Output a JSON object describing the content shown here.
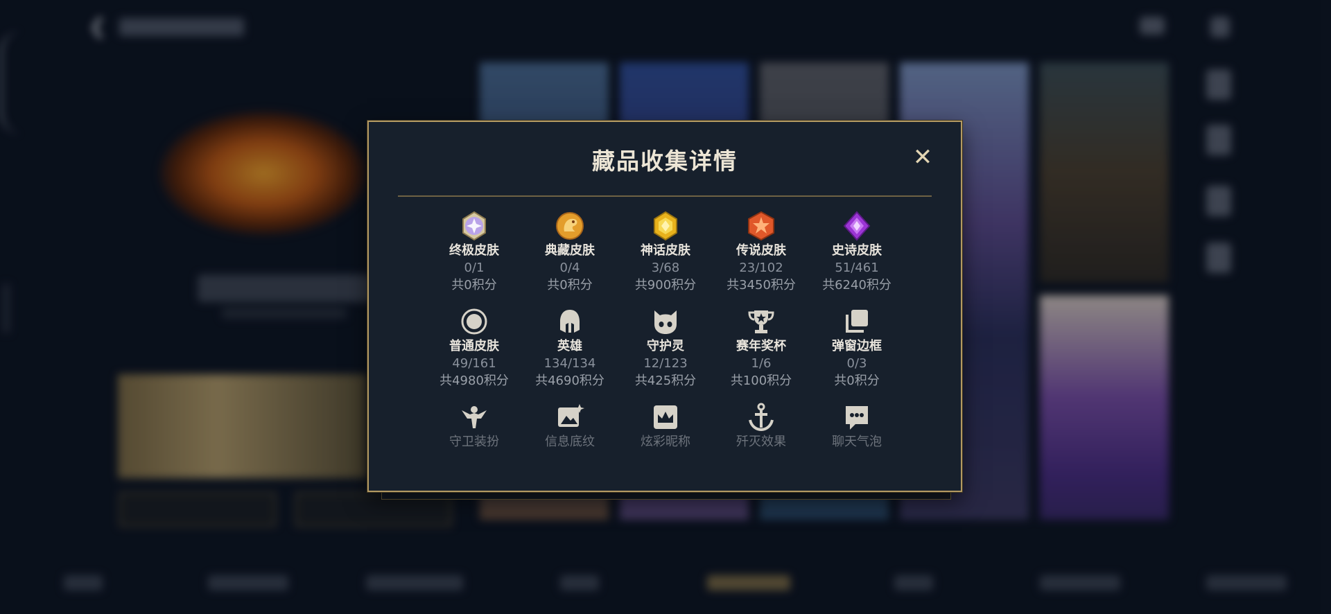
{
  "dialog": {
    "title": "藏品收集详情",
    "close_icon": "close-icon"
  },
  "colors": {
    "gold_border": "#b49a62",
    "dialog_bg": "#17202c",
    "title_text": "#ece5d5",
    "muted_text": "#8a919c"
  },
  "categories": [
    {
      "name": "终极皮肤",
      "count": "0/1",
      "points": "共0积分",
      "icon": "ultimate-skin-icon"
    },
    {
      "name": "典藏皮肤",
      "count": "0/4",
      "points": "共0积分",
      "icon": "collection-skin-icon"
    },
    {
      "name": "神话皮肤",
      "count": "3/68",
      "points": "共900积分",
      "icon": "mythic-skin-icon"
    },
    {
      "name": "传说皮肤",
      "count": "23/102",
      "points": "共3450积分",
      "icon": "legendary-skin-icon"
    },
    {
      "name": "史诗皮肤",
      "count": "51/461",
      "points": "共6240积分",
      "icon": "epic-skin-icon"
    },
    {
      "name": "普通皮肤",
      "count": "49/161",
      "points": "共4980积分",
      "icon": "normal-skin-icon"
    },
    {
      "name": "英雄",
      "count": "134/134",
      "points": "共4690积分",
      "icon": "hero-helmet-icon"
    },
    {
      "name": "守护灵",
      "count": "12/123",
      "points": "共425积分",
      "icon": "guardian-spirit-icon"
    },
    {
      "name": "赛年奖杯",
      "count": "1/6",
      "points": "共100积分",
      "icon": "trophy-icon"
    },
    {
      "name": "弹窗边框",
      "count": "0/3",
      "points": "共0积分",
      "icon": "popup-frame-icon"
    },
    {
      "name": "守卫装扮",
      "icon": "guard-outfit-icon"
    },
    {
      "name": "信息底纹",
      "icon": "info-background-icon"
    },
    {
      "name": "炫彩昵称",
      "icon": "colorful-nickname-icon"
    },
    {
      "name": "歼灭效果",
      "icon": "annihilation-effect-icon"
    },
    {
      "name": "聊天气泡",
      "icon": "chat-bubble-icon"
    }
  ]
}
